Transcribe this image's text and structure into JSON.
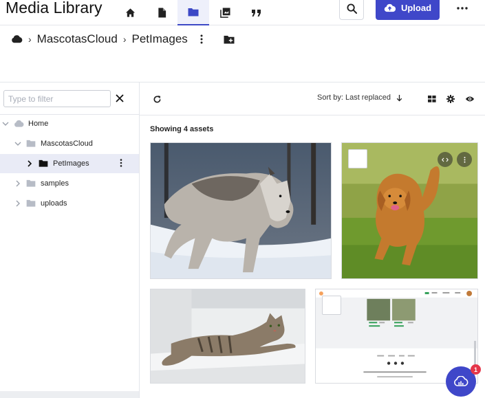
{
  "header": {
    "title": "Media Library",
    "nav_icons": [
      "home-icon",
      "document-icon",
      "folder-icon",
      "collections-icon",
      "quote-icon"
    ],
    "active_nav": "folder-icon",
    "search_icon": "search-icon",
    "upload_label": "Upload",
    "more_icon": "more-horizontal-icon",
    "accent": "#3f47c9"
  },
  "breadcrumb": {
    "items": [
      "MascotasCloud",
      "PetImages"
    ]
  },
  "sidebar": {
    "filter_placeholder": "Type to filter",
    "filter_value": "",
    "tree": [
      {
        "label": "Home",
        "level": 0,
        "expanded": true
      },
      {
        "label": "MascotasCloud",
        "level": 1,
        "expanded": true
      },
      {
        "label": "PetImages",
        "level": 2,
        "selected": true
      },
      {
        "label": "samples",
        "level": 1
      },
      {
        "label": "uploads",
        "level": 1
      }
    ]
  },
  "toolbar": {
    "sort_label": "Sort by: Last replaced",
    "sort_direction": "descending"
  },
  "main": {
    "showing_text": "Showing 4 assets",
    "assets": [
      {
        "subject": "wolf"
      },
      {
        "subject": "dog"
      },
      {
        "subject": "cat"
      },
      {
        "subject": "webpage"
      }
    ]
  },
  "fab": {
    "badge": "1"
  }
}
